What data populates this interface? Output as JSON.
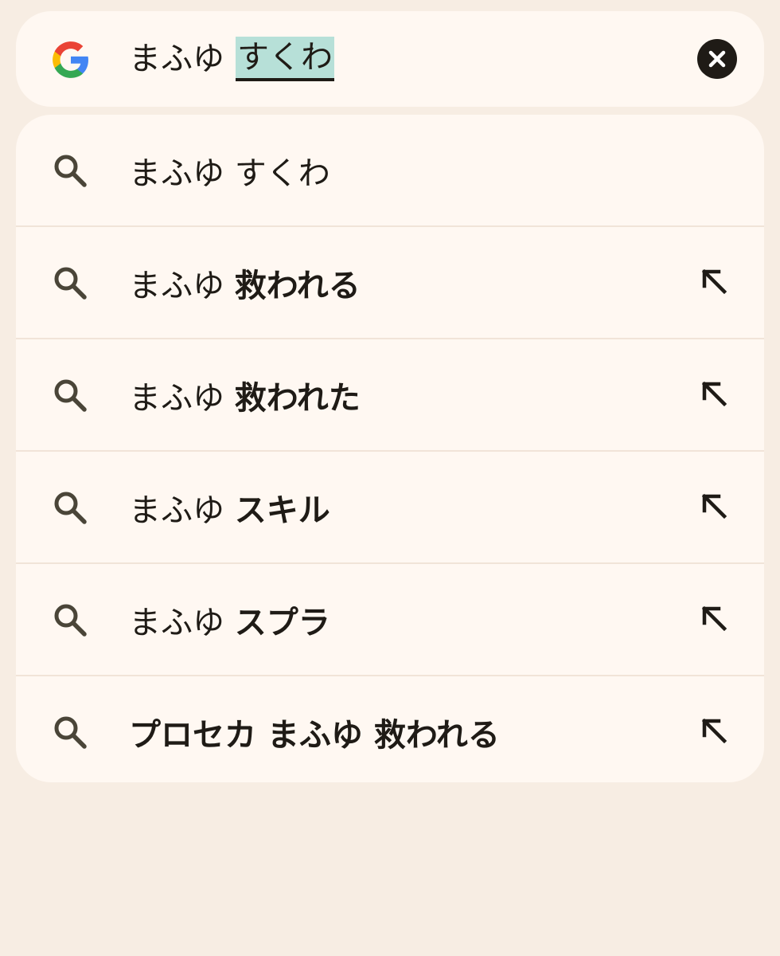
{
  "search": {
    "typed_text": "まふゆ",
    "composing_text": "すくわ"
  },
  "suggestions": [
    {
      "prefix": "まふゆ すくわ",
      "completion": "",
      "has_fill": false
    },
    {
      "prefix": "まふゆ",
      "completion": "救われる",
      "has_fill": true
    },
    {
      "prefix": "まふゆ",
      "completion": "救われた",
      "has_fill": true
    },
    {
      "prefix": "まふゆ",
      "completion": "スキル",
      "has_fill": true
    },
    {
      "prefix": "まふゆ",
      "completion": "スプラ",
      "has_fill": true
    },
    {
      "prefix": "",
      "completion": "プロセカ まふゆ 救われる",
      "has_fill": true
    }
  ],
  "colors": {
    "background": "#f7ede3",
    "surface": "#fff8f2",
    "composing_highlight": "#b7e0d8",
    "icon": "#4a4538"
  }
}
